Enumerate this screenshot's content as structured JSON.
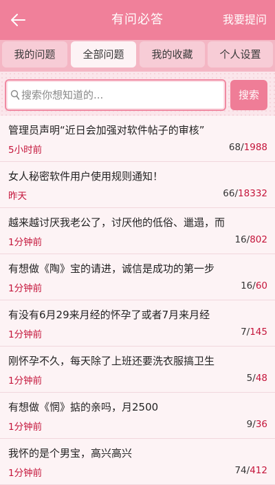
{
  "header": {
    "title": "有问必答",
    "ask_label": "我要提问"
  },
  "tabs": [
    {
      "label": "我的问题",
      "active": false
    },
    {
      "label": "全部问题",
      "active": true
    },
    {
      "label": "我的收藏",
      "active": false
    },
    {
      "label": "个人设置",
      "active": false
    }
  ],
  "search": {
    "placeholder": "搜索你想知道的...",
    "value": "",
    "button_label": "搜索"
  },
  "colors": {
    "accent": "#f0809a",
    "time": "#c4143a"
  },
  "questions": [
    {
      "title": "管理员声明“近日会加强对软件帖子的审核”",
      "time": "5小时前",
      "replies": "68",
      "views": "1988"
    },
    {
      "title": "女人秘密软件用户使用规则通知！",
      "time": "昨天",
      "replies": "66",
      "views": "18332"
    },
    {
      "title": "越来越讨厌我老公了，讨厌他的低俗、邋遢，而",
      "time": "1分钟前",
      "replies": "16",
      "views": "802"
    },
    {
      "title": "有想做《陶》宝的请进，诚信是成功的第一步",
      "time": "1分钟前",
      "replies": "16",
      "views": "60"
    },
    {
      "title": "有没有6月29来月经的怀孕了或者7月来月经",
      "time": "1分钟前",
      "replies": "7",
      "views": "145"
    },
    {
      "title": "刚怀孕不久，每天除了上班还要洗衣服搞卫生",
      "time": "1分钟前",
      "replies": "5",
      "views": "48"
    },
    {
      "title": "有想做《惘》掂的亲吗，月2500",
      "time": "1分钟前",
      "replies": "9",
      "views": "36"
    },
    {
      "title": "我怀的是个男宝，高兴高兴",
      "time": "1分钟前",
      "replies": "74",
      "views": "412"
    }
  ]
}
